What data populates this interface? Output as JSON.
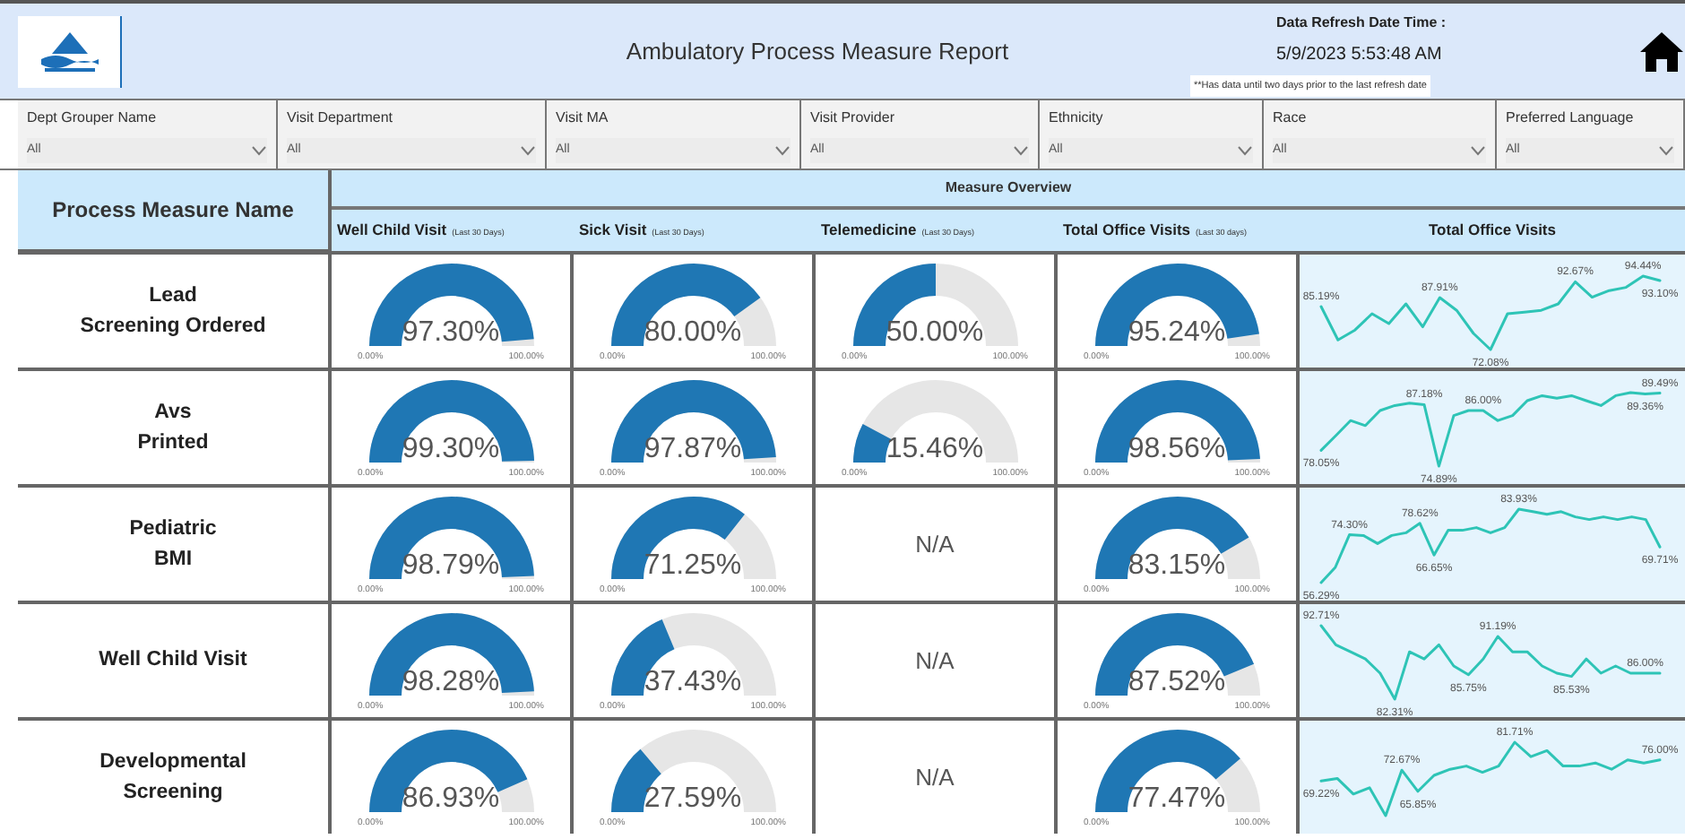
{
  "header": {
    "title": "Ambulatory Process Measure Report",
    "refresh_label": "Data Refresh Date Time :",
    "refresh_value": "5/9/2023 5:53:48 AM",
    "refresh_note": "**Has data until two days prior to the last refresh date"
  },
  "filters": [
    {
      "label": "Dept Grouper Name",
      "value": "All"
    },
    {
      "label": "Visit Department",
      "value": "All"
    },
    {
      "label": "Visit MA",
      "value": "All"
    },
    {
      "label": "Visit Provider",
      "value": "All"
    },
    {
      "label": "Ethnicity",
      "value": "All"
    },
    {
      "label": "Race",
      "value": "All"
    },
    {
      "label": "Preferred Language",
      "value": "All"
    }
  ],
  "table": {
    "name_header": "Process Measure Name",
    "group_header": "Measure Overview",
    "columns": [
      {
        "title": "Well Child Visit",
        "note": "(Last 30 Days)"
      },
      {
        "title": "Sick Visit",
        "note": "(Last 30 Days)"
      },
      {
        "title": "Telemedicine",
        "note": "(Last 30 Days)"
      },
      {
        "title": "Total Office Visits",
        "note": "(Last 30 days)"
      },
      {
        "title": "Total Office Visits"
      }
    ],
    "rows": [
      {
        "name": [
          "Lead",
          "Screening Ordered"
        ],
        "gauges": [
          {
            "kind": "gauge",
            "value": "97.30%",
            "min": "0.00%",
            "max": "100.00%"
          },
          {
            "kind": "gauge",
            "value": "80.00%",
            "min": "0.00%",
            "max": "100.00%"
          },
          {
            "kind": "gauge",
            "value": "50.00%",
            "min": "0.00%",
            "max": "100.00%"
          },
          {
            "kind": "gauge",
            "value": "95.24%",
            "min": "0.00%",
            "max": "100.00%"
          }
        ],
        "trend_labels": [
          "85.19%",
          "87.91%",
          "72.08%",
          "92.67%",
          "94.44%",
          "93.10%"
        ]
      },
      {
        "name": [
          "Avs",
          "Printed"
        ],
        "gauges": [
          {
            "kind": "gauge",
            "value": "99.30%",
            "min": "0.00%",
            "max": "100.00%"
          },
          {
            "kind": "gauge",
            "value": "97.87%",
            "min": "0.00%",
            "max": "100.00%"
          },
          {
            "kind": "gauge",
            "value": "15.46%",
            "min": "0.00%",
            "max": "100.00%"
          },
          {
            "kind": "gauge",
            "value": "98.56%",
            "min": "0.00%",
            "max": "100.00%"
          }
        ],
        "trend_labels": [
          "78.05%",
          "87.18%",
          "74.89%",
          "86.00%",
          "89.36%",
          "89.49%"
        ]
      },
      {
        "name": [
          "Pediatric",
          "BMI"
        ],
        "gauges": [
          {
            "kind": "gauge",
            "value": "98.79%",
            "min": "0.00%",
            "max": "100.00%"
          },
          {
            "kind": "gauge",
            "value": "71.25%",
            "min": "0.00%",
            "max": "100.00%"
          },
          {
            "kind": "na",
            "value": "N/A"
          },
          {
            "kind": "gauge",
            "value": "83.15%",
            "min": "0.00%",
            "max": "100.00%"
          }
        ],
        "trend_labels": [
          "56.29%",
          "74.30%",
          "78.62%",
          "66.65%",
          "83.93%",
          "69.71%"
        ]
      },
      {
        "name": [
          "Well Child Visit"
        ],
        "gauges": [
          {
            "kind": "gauge",
            "value": "98.28%",
            "min": "0.00%",
            "max": "100.00%"
          },
          {
            "kind": "gauge",
            "value": "37.43%",
            "min": "0.00%",
            "max": "100.00%"
          },
          {
            "kind": "na",
            "value": "N/A"
          },
          {
            "kind": "gauge",
            "value": "87.52%",
            "min": "0.00%",
            "max": "100.00%"
          }
        ],
        "trend_labels": [
          "92.71%",
          "82.31%",
          "85.75%",
          "91.19%",
          "85.53%",
          "86.00%"
        ]
      },
      {
        "name": [
          "Developmental",
          "Screening"
        ],
        "gauges": [
          {
            "kind": "gauge",
            "value": "86.93%",
            "min": "0.00%",
            "max": "100.00%"
          },
          {
            "kind": "gauge",
            "value": "27.59%",
            "min": "0.00%",
            "max": "100.00%"
          },
          {
            "kind": "na",
            "value": "N/A"
          },
          {
            "kind": "gauge",
            "value": "77.47%",
            "min": "0.00%",
            "max": "100.00%"
          }
        ],
        "trend_labels": [
          "69.22%",
          "72.67%",
          "65.85%",
          "81.71%",
          "76.00%"
        ]
      }
    ]
  }
}
